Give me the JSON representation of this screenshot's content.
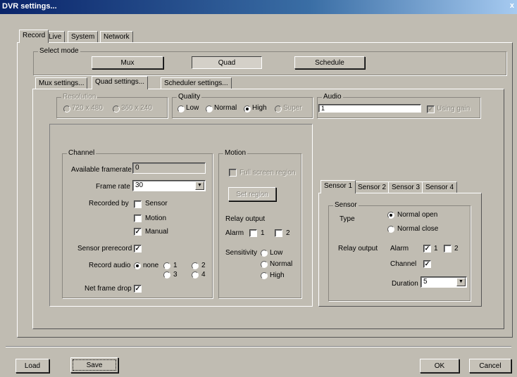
{
  "window": {
    "title": "DVR settings...",
    "close": "x"
  },
  "main_tabs": [
    "Record",
    "Live",
    "System",
    "Network"
  ],
  "select_mode": {
    "label": "Select mode",
    "buttons": [
      "Mux",
      "Quad",
      "Schedule"
    ]
  },
  "sub_tabs": [
    "Mux settings...",
    "Quad settings...",
    "Scheduler settings..."
  ],
  "resolution": {
    "label": "Resolution",
    "options": [
      "720 x 480",
      "360 x 240"
    ]
  },
  "quality": {
    "label": "Quality",
    "options": [
      "Low",
      "Normal",
      "High",
      "Super"
    ],
    "selected": "High"
  },
  "audio": {
    "label": "Audio",
    "value": "1",
    "check_label": "Using gain"
  },
  "channel": {
    "label": "Channel",
    "available_framerate_label": "Available framerate",
    "available_framerate_value": "0",
    "frame_rate_label": "Frame rate",
    "frame_rate_value": "30",
    "recorded_by_label": "Recorded by",
    "recorded_by": [
      "Sensor",
      "Motion",
      "Manual"
    ],
    "sensor_prerecord_label": "Sensor prerecord",
    "record_audio_label": "Record audio",
    "record_audio_options": [
      "none",
      "1",
      "2",
      "3",
      "4"
    ],
    "net_frame_drop_label": "Net frame drop"
  },
  "motion": {
    "label": "Motion",
    "full_screen_label": "Full screen region",
    "set_region_label": "Set region",
    "relay_output_label": "Relay output",
    "alarm_label": "Alarm",
    "alarm_options": [
      "1",
      "2"
    ],
    "sensitivity_label": "Sensitivity",
    "sensitivity_options": [
      "Low",
      "Normal",
      "High"
    ]
  },
  "sensor_tabs": [
    "Sensor 1",
    "Sensor 2",
    "Sensor 3",
    "Sensor 4"
  ],
  "sensor": {
    "label": "Sensor",
    "type_label": "Type",
    "type_options": [
      "Normal open",
      "Normal close"
    ],
    "relay_output_label": "Relay output",
    "alarm_label": "Alarm",
    "alarm_options": [
      "1",
      "2"
    ],
    "channel_label": "Channel",
    "duration_label": "Duration",
    "duration_value": "5"
  },
  "footer": {
    "load": "Load",
    "save": "Save",
    "ok": "OK",
    "cancel": "Cancel"
  }
}
